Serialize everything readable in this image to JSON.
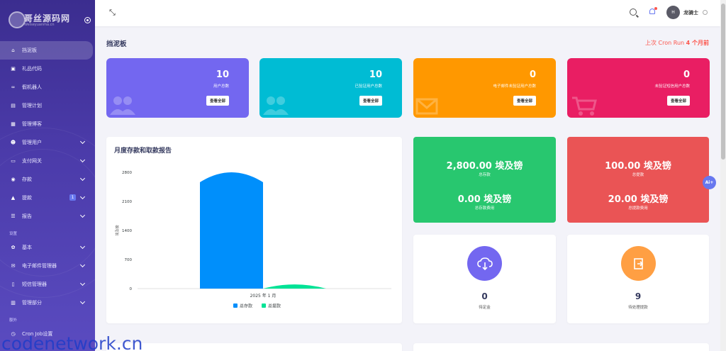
{
  "brand": {
    "name": "哥丝源码网",
    "tagline": "Weiseyuanma.cn"
  },
  "sidebar": {
    "items": [
      {
        "label": "挡泥板",
        "icon": "home-icon",
        "active": true
      },
      {
        "label": "礼品代码",
        "icon": "gift-icon"
      },
      {
        "label": "假机器人",
        "icon": "link-icon"
      },
      {
        "label": "管理计划",
        "icon": "plan-icon"
      },
      {
        "label": "管理博客",
        "icon": "blog-icon"
      },
      {
        "label": "管理用户",
        "icon": "users-icon",
        "chevron": true
      },
      {
        "label": "支付网关",
        "icon": "credit-card-icon",
        "chevron": true
      },
      {
        "label": "存款",
        "icon": "deposit-icon",
        "chevron": true
      },
      {
        "label": "提款",
        "icon": "bank-icon",
        "chevron": true,
        "badge": "1"
      },
      {
        "label": "报告",
        "icon": "list-icon",
        "chevron": true
      }
    ],
    "section_settings": "设置",
    "settings_items": [
      {
        "label": "基本",
        "icon": "gear-icon",
        "chevron": true
      },
      {
        "label": "电子邮件管理器",
        "icon": "envelope-icon",
        "chevron": true
      },
      {
        "label": "短信管理器",
        "icon": "mobile-icon",
        "chevron": true
      },
      {
        "label": "管理部分",
        "icon": "section-icon",
        "chevron": true
      }
    ],
    "section_extra": "额外",
    "extra_items": [
      {
        "label": "Cron Job设置",
        "icon": "clock-icon"
      }
    ]
  },
  "topbar": {
    "avatar_initial": "H",
    "user_name": "龙骑士"
  },
  "page": {
    "title": "挡泥板",
    "cron_prefix": "上次 Cron Run",
    "cron_value": "4 个月前"
  },
  "stats": [
    {
      "value": "10",
      "label": "用户总数",
      "button": "查看全部",
      "color": "#7367f0",
      "icon": "users-icon"
    },
    {
      "value": "10",
      "label": "已验证用户总数",
      "button": "查看全部",
      "color": "#00bcd4",
      "icon": "user-check-icon"
    },
    {
      "value": "0",
      "label": "电子邮件未验证用户总数",
      "button": "查看全部",
      "color": "#ff9800",
      "icon": "envelope-icon"
    },
    {
      "value": "0",
      "label": "未验证短信用户总数",
      "button": "查看全部",
      "color": "#e91e63",
      "icon": "cart-icon"
    }
  ],
  "chart": {
    "title": "月度存款和取款报告"
  },
  "chart_data": {
    "type": "bar",
    "categories": [
      "2025 年 1 月"
    ],
    "series": [
      {
        "name": "总存款",
        "values": [
          2800
        ],
        "color": "#008ffb"
      },
      {
        "name": "总提款",
        "values": [
          100
        ],
        "color": "#00e396"
      }
    ],
    "ylabel": "埃及镑",
    "xlabel": "",
    "ylim": [
      0,
      2800
    ],
    "yticks": [
      "2800",
      "2100",
      "1400",
      "700",
      "0"
    ],
    "legend": "bottom"
  },
  "summary": {
    "deposit": {
      "amount": "2,800.00 埃及镑",
      "label": "总存款",
      "charge": "0.00 埃及镑",
      "charge_label": "总存款费用",
      "color": "#28c76f"
    },
    "withdraw": {
      "amount": "100.00 埃及镑",
      "label": "总提款",
      "charge": "20.00 埃及镑",
      "charge_label": "总提款费用",
      "color": "#ea5455"
    }
  },
  "mini": [
    {
      "value": "0",
      "label": "待定金",
      "color": "#7367f0",
      "icon": "cloud-download-icon"
    },
    {
      "value": "9",
      "label": "待处理提款",
      "color": "#ff9f43",
      "icon": "exit-icon"
    }
  ],
  "ai_button": "Ai+",
  "watermark": "codenetwork.cn"
}
